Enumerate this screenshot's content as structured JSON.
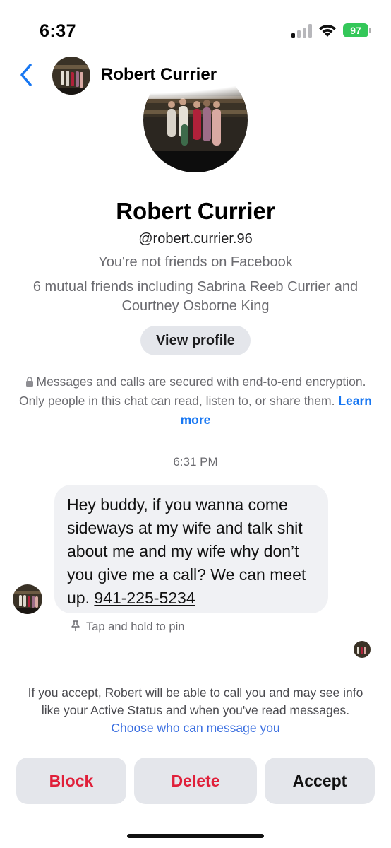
{
  "status_bar": {
    "time": "6:37",
    "battery": "97",
    "battery_color": "#34c759"
  },
  "header": {
    "back_icon": "chevron-left-icon",
    "name": "Robert Currier"
  },
  "profile": {
    "name": "Robert Currier",
    "username": "@robert.currier.96",
    "friend_status": "You're not friends on Facebook",
    "mutual_friends": "6 mutual friends including Sabrina Reeb Currier and Courtney Osborne King",
    "view_profile_label": "View profile"
  },
  "encryption": {
    "icon": "lock-icon",
    "text": "Messages and calls are secured with end-to-end encryption. Only people in this chat can read, listen to, or share them.",
    "link": "Learn more"
  },
  "conversation": {
    "timestamp": "6:31 PM",
    "message": {
      "text": "Hey buddy, if you wanna come sideways at my wife and talk shit about me and my wife why don’t you give me a call? We can meet up.",
      "phone": "941-225-5234"
    },
    "pin_hint": "Tap and hold to pin",
    "pin_icon": "pin-icon"
  },
  "request": {
    "info_text": "If you accept, Robert will be able to call you and may see info like your Active Status and when you've read messages.",
    "info_link": "Choose who can message you",
    "block_label": "Block",
    "delete_label": "Delete",
    "accept_label": "Accept"
  },
  "colors": {
    "accent": "#1877f2",
    "danger": "#e0203a",
    "button_bg": "#e4e6eb",
    "bubble_bg": "#f0f1f4"
  }
}
